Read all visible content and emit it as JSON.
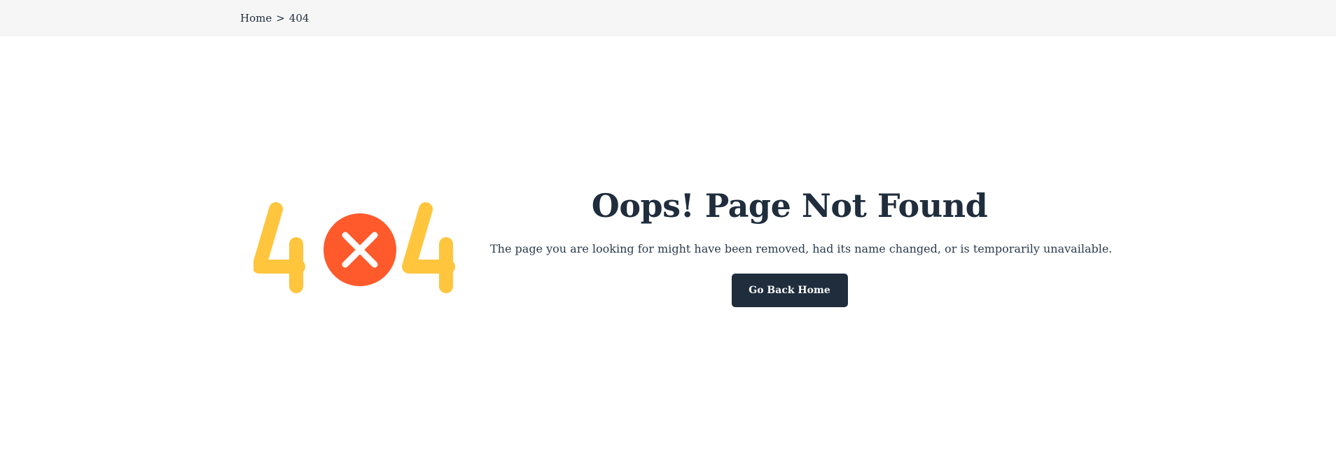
{
  "breadcrumb": {
    "home": "Home",
    "separator": ">",
    "current": "404"
  },
  "illustration": {
    "left_digit": "4",
    "right_digit": "4",
    "center_icon": "close-circle-icon",
    "digit_color": "#ffc53d",
    "circle_color": "#ff5a2c"
  },
  "error": {
    "title": "Oops! Page Not Found",
    "message": "The page you are looking for might have been removed, had its name changed, or is temporarily unavailable.",
    "button_label": "Go Back Home"
  },
  "colors": {
    "text_dark": "#1f2d3d",
    "breadcrumb_bg": "#f6f6f6"
  }
}
